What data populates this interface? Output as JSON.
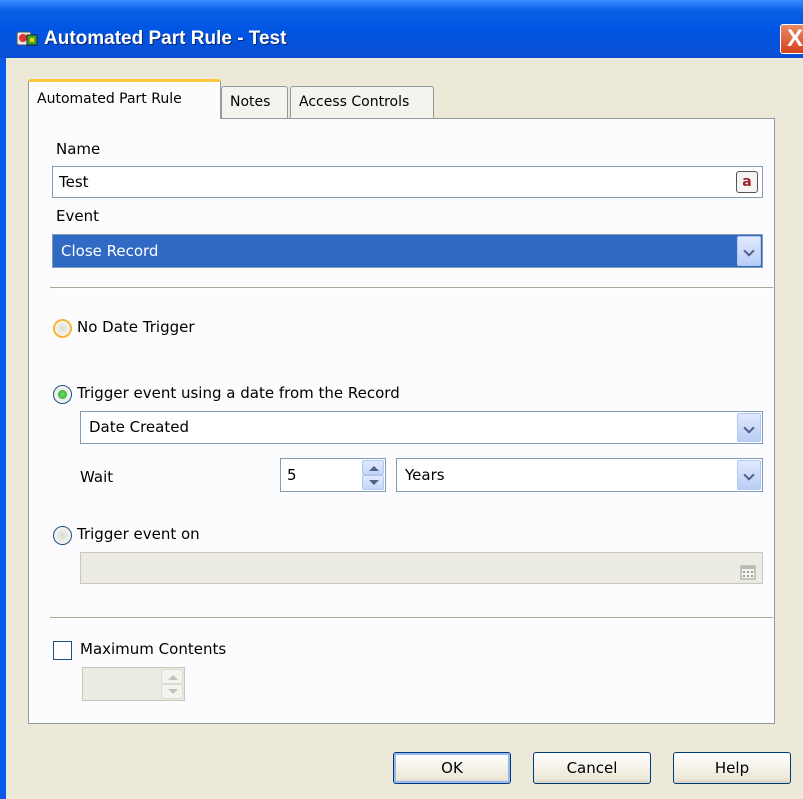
{
  "window": {
    "title": "Automated Part Rule - Test",
    "close_glyph": "X"
  },
  "tabs": [
    {
      "label": "Automated Part Rule",
      "active": true
    },
    {
      "label": "Notes",
      "active": false
    },
    {
      "label": "Access Controls",
      "active": false
    }
  ],
  "form": {
    "name_label": "Name",
    "name_value": "Test",
    "name_icon_glyph": "a",
    "event_label": "Event",
    "event_value": "Close Record"
  },
  "trigger": {
    "no_date_label": "No Date Trigger",
    "record_date_label": "Trigger event using a date from the Record",
    "record_date_field": "Date Created",
    "wait_label": "Wait",
    "wait_value": "5",
    "wait_unit": "Years",
    "trigger_on_label": "Trigger event on",
    "trigger_on_value": "",
    "selected": "record_date"
  },
  "max_contents": {
    "label": "Maximum Contents",
    "checked": false,
    "value": ""
  },
  "buttons": {
    "ok": "OK",
    "cancel": "Cancel",
    "help": "Help"
  },
  "colors": {
    "title_bar": "#0054e3",
    "selection": "#316ac5",
    "window_bg": "#ece9d8"
  }
}
